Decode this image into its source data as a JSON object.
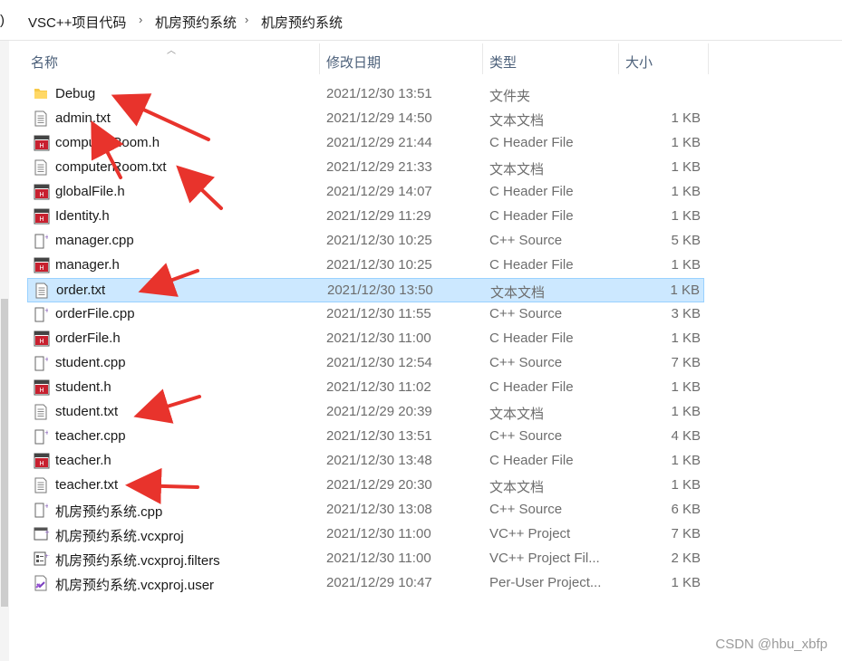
{
  "breadcrumb": {
    "lead": ")",
    "items": [
      "VSC++项目代码",
      "机房预约系统",
      "机房预约系统"
    ],
    "separator": "›"
  },
  "columns": {
    "name": "名称",
    "date": "修改日期",
    "type": "类型",
    "size": "大小"
  },
  "files": [
    {
      "name": "Debug",
      "date": "2021/12/30 13:51",
      "type": "文件夹",
      "size": "",
      "icon": "folder-icon",
      "selected": false
    },
    {
      "name": "admin.txt",
      "date": "2021/12/29 14:50",
      "type": "文本文档",
      "size": "1 KB",
      "icon": "text-file-icon",
      "selected": false
    },
    {
      "name": "computerRoom.h",
      "date": "2021/12/29 21:44",
      "type": "C Header File",
      "size": "1 KB",
      "icon": "header-file-icon",
      "selected": false
    },
    {
      "name": "computerRoom.txt",
      "date": "2021/12/29 21:33",
      "type": "文本文档",
      "size": "1 KB",
      "icon": "text-file-icon",
      "selected": false
    },
    {
      "name": "globalFile.h",
      "date": "2021/12/29 14:07",
      "type": "C Header File",
      "size": "1 KB",
      "icon": "header-file-icon",
      "selected": false
    },
    {
      "name": "Identity.h",
      "date": "2021/12/29 11:29",
      "type": "C Header File",
      "size": "1 KB",
      "icon": "header-file-icon",
      "selected": false
    },
    {
      "name": "manager.cpp",
      "date": "2021/12/30 10:25",
      "type": "C++ Source",
      "size": "5 KB",
      "icon": "cpp-file-icon",
      "selected": false
    },
    {
      "name": "manager.h",
      "date": "2021/12/30 10:25",
      "type": "C Header File",
      "size": "1 KB",
      "icon": "header-file-icon",
      "selected": false
    },
    {
      "name": "order.txt",
      "date": "2021/12/30 13:50",
      "type": "文本文档",
      "size": "1 KB",
      "icon": "text-file-icon",
      "selected": true
    },
    {
      "name": "orderFile.cpp",
      "date": "2021/12/30 11:55",
      "type": "C++ Source",
      "size": "3 KB",
      "icon": "cpp-file-icon",
      "selected": false
    },
    {
      "name": "orderFile.h",
      "date": "2021/12/30 11:00",
      "type": "C Header File",
      "size": "1 KB",
      "icon": "header-file-icon",
      "selected": false
    },
    {
      "name": "student.cpp",
      "date": "2021/12/30 12:54",
      "type": "C++ Source",
      "size": "7 KB",
      "icon": "cpp-file-icon",
      "selected": false
    },
    {
      "name": "student.h",
      "date": "2021/12/30 11:02",
      "type": "C Header File",
      "size": "1 KB",
      "icon": "header-file-icon",
      "selected": false
    },
    {
      "name": "student.txt",
      "date": "2021/12/29 20:39",
      "type": "文本文档",
      "size": "1 KB",
      "icon": "text-file-icon",
      "selected": false
    },
    {
      "name": "teacher.cpp",
      "date": "2021/12/30 13:51",
      "type": "C++ Source",
      "size": "4 KB",
      "icon": "cpp-file-icon",
      "selected": false
    },
    {
      "name": "teacher.h",
      "date": "2021/12/30 13:48",
      "type": "C Header File",
      "size": "1 KB",
      "icon": "header-file-icon",
      "selected": false
    },
    {
      "name": "teacher.txt",
      "date": "2021/12/29 20:30",
      "type": "文本文档",
      "size": "1 KB",
      "icon": "text-file-icon",
      "selected": false
    },
    {
      "name": "机房预约系统.cpp",
      "date": "2021/12/30 13:08",
      "type": "C++ Source",
      "size": "6 KB",
      "icon": "cpp-file-icon",
      "selected": false
    },
    {
      "name": "机房预约系统.vcxproj",
      "date": "2021/12/30 11:00",
      "type": "VC++ Project",
      "size": "7 KB",
      "icon": "vcxproj-icon",
      "selected": false
    },
    {
      "name": "机房预约系统.vcxproj.filters",
      "date": "2021/12/30 11:00",
      "type": "VC++ Project Fil...",
      "size": "2 KB",
      "icon": "filters-file-icon",
      "selected": false
    },
    {
      "name": "机房预约系统.vcxproj.user",
      "date": "2021/12/29 10:47",
      "type": "Per-User Project...",
      "size": "1 KB",
      "icon": "vs-user-file-icon",
      "selected": false
    }
  ],
  "watermark": "CSDN @hbu_xbfp",
  "colors": {
    "selection_bg": "#cce8ff",
    "selection_border": "#99d1ff",
    "annotation_arrow": "#e8332c",
    "header_text": "#4c607a"
  }
}
